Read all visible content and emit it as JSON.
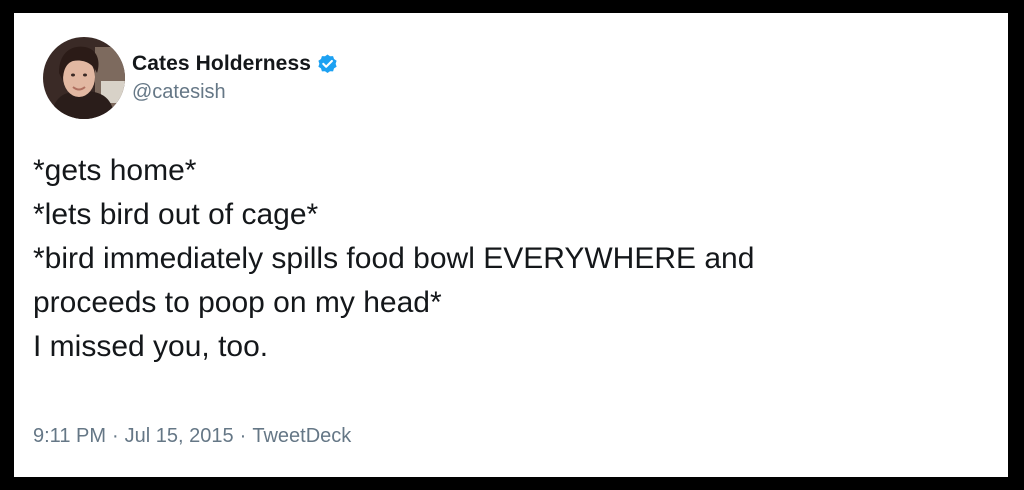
{
  "tweet": {
    "author": {
      "display_name": "Cates Holderness",
      "handle": "@catesish",
      "verified": true,
      "avatar_icon": "profile-photo"
    },
    "lines": [
      "*gets home*",
      "*lets bird out of cage*",
      "*bird immediately spills food bowl EVERYWHERE and",
      "proceeds to poop on my head*",
      "I missed you, too."
    ],
    "meta": {
      "time": "9:11 PM",
      "sep1": "·",
      "date": "Jul 15, 2015",
      "sep2": "·",
      "source": "TweetDeck"
    }
  },
  "colors": {
    "frame": "#000000",
    "card": "#ffffff",
    "text": "#14171a",
    "muted": "#657786",
    "verified_blue": "#1da1f2"
  }
}
